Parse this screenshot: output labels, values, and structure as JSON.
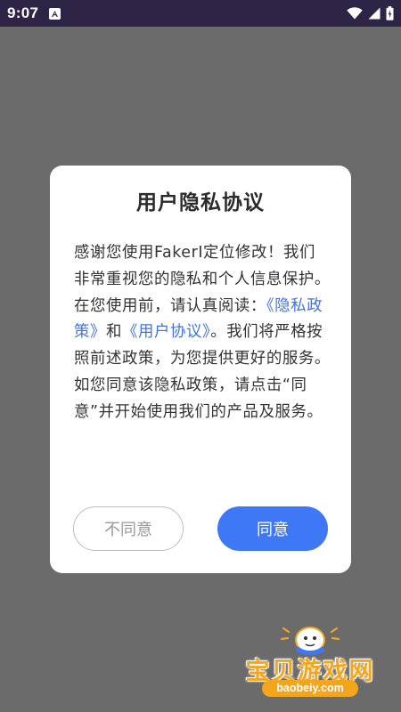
{
  "status_bar": {
    "time": "9:07",
    "icons": [
      "notification-a-icon",
      "wifi-icon",
      "signal-icon",
      "battery-icon"
    ]
  },
  "dialog": {
    "title": "用户隐私协议",
    "body_part1": "感谢您使用FakerI定位修改！我们非常重视您的隐私和个人信息保护。在您使用前，请认真阅读：",
    "privacy_link": "《隐私政策》",
    "and_text": "和",
    "user_link": "《用户协议》",
    "body_part2": "。我们将严格按照前述政策，为您提供更好的服务。如您同意该隐私政策，请点击“同意”并开始使用我们的产品及服务。",
    "decline_label": "不同意",
    "agree_label": "同意"
  },
  "watermark": {
    "brand": "宝贝游戏网",
    "url": "baobeiy.com"
  },
  "colors": {
    "status_bar": "#2d2446",
    "overlay": "#6b6b6b",
    "link": "#3f74e6",
    "primary_button": "#3f78f6",
    "watermark": "#f4a51c"
  }
}
